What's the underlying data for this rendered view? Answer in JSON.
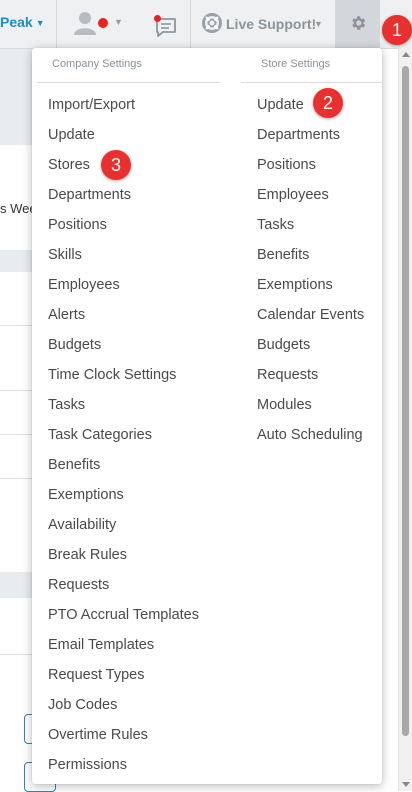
{
  "topbar": {
    "brand_label": "Peak",
    "support_label": "Live Support!",
    "icons": {
      "avatar": "user-icon",
      "chat": "chat-icon",
      "support": "lifebuoy-icon",
      "settings": "gear-icon"
    },
    "colors": {
      "brand": "#1a8fc9",
      "alert": "#e8231f"
    }
  },
  "background": {
    "partial_text": "s Wee"
  },
  "menu": {
    "company": {
      "header": "Company Settings",
      "items": [
        "Import/Export",
        "Update",
        "Stores",
        "Departments",
        "Positions",
        "Skills",
        "Employees",
        "Alerts",
        "Budgets",
        "Time Clock Settings",
        "Tasks",
        "Task Categories",
        "Benefits",
        "Exemptions",
        "Availability",
        "Break Rules",
        "Requests",
        "PTO Accrual Templates",
        "Email Templates",
        "Request Types",
        "Job Codes",
        "Overtime Rules",
        "Permissions"
      ]
    },
    "store": {
      "header": "Store Settings",
      "items": [
        "Update",
        "Departments",
        "Positions",
        "Employees",
        "Tasks",
        "Benefits",
        "Exemptions",
        "Calendar Events",
        "Budgets",
        "Requests",
        "Modules",
        "Auto Scheduling"
      ]
    }
  },
  "badges": [
    "1",
    "2",
    "3"
  ],
  "badge_color": "#e8302f"
}
